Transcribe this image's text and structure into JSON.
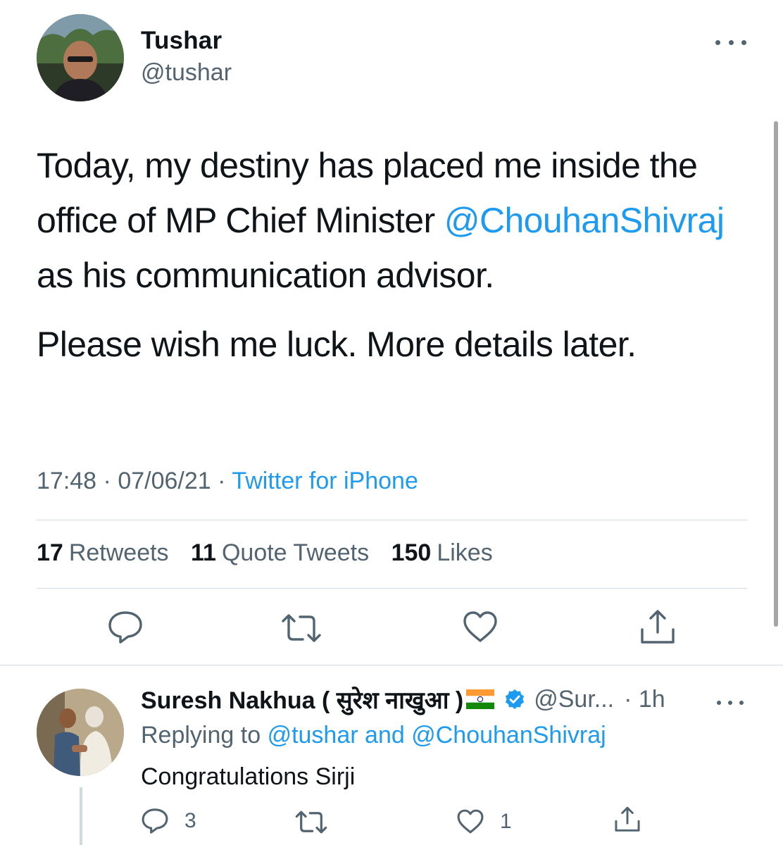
{
  "tweet": {
    "author_name": "Tushar",
    "author_handle": "@tushar",
    "text_part1": "Today, my destiny has placed me inside the office of MP Chief Minister ",
    "mention": "@ChouhanShivraj",
    "text_part2": " as his communication advisor.",
    "text_paragraph2": "Please wish me luck. More details later.",
    "time": "17:48",
    "date": "07/06/21",
    "separator": "·",
    "source": "Twitter for iPhone",
    "stats": {
      "retweets_count": "17",
      "retweets_label": "Retweets",
      "quotes_count": "11",
      "quotes_label": "Quote Tweets",
      "likes_count": "150",
      "likes_label": "Likes"
    },
    "actions": [
      "reply-icon",
      "retweet-icon",
      "like-icon",
      "share-icon"
    ]
  },
  "reply": {
    "author_name": "Suresh Nakhua ( सुरेश नाखुआ )",
    "flag": "india-flag",
    "verified": true,
    "author_handle": "@Sur...",
    "time": "· 1h",
    "replying_prefix": "Replying to",
    "replying_to_1": "@tushar",
    "replying_joiner": "and",
    "replying_to_2": "@ChouhanShivraj",
    "text": "Congratulations Sirji",
    "reply_count": "3",
    "retweet_count": "",
    "like_count": "1"
  },
  "colors": {
    "accent": "#1d9bf0",
    "text": "#0f1419",
    "secondary": "#536471",
    "divider": "#cfd9de"
  }
}
